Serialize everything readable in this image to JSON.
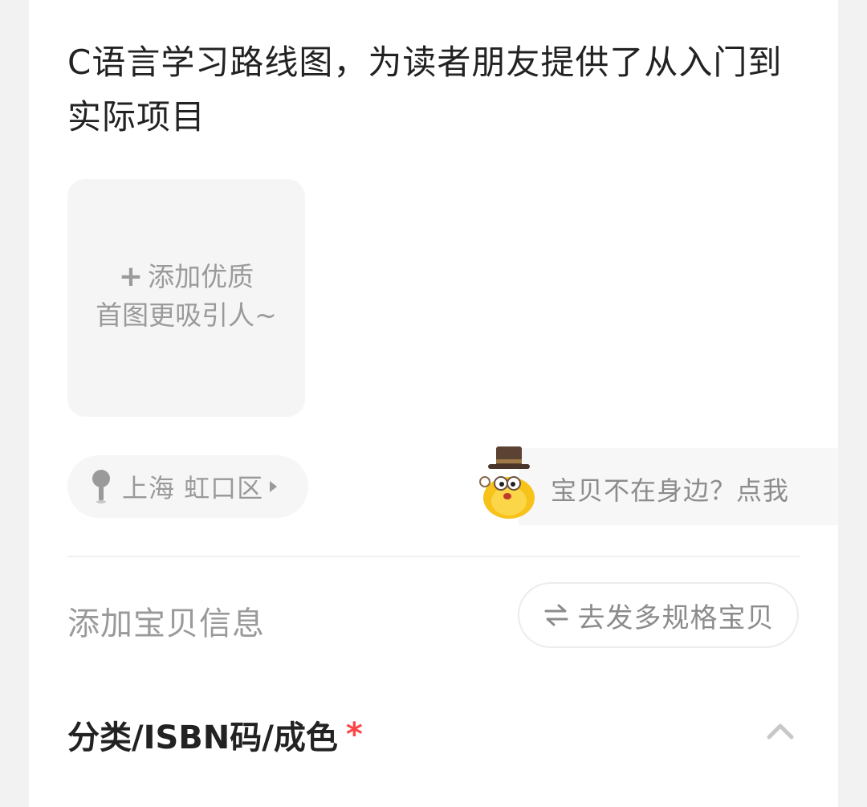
{
  "listing": {
    "description": "C语言学习路线图，为读者朋友提供了从入门到实际项目"
  },
  "photo_uploader": {
    "line1": "添加优质",
    "line2": "首图更吸引人~",
    "icon": "plus-icon"
  },
  "location": {
    "text": "上海 虹口区",
    "icon": "pin-icon"
  },
  "helper": {
    "text": "宝贝不在身边？点我",
    "icon": "mascot-icon"
  },
  "item_info": {
    "section_title": "添加宝贝信息",
    "multi_spec_button": "去发多规格宝贝",
    "multi_spec_icon": "swap-icon"
  },
  "category": {
    "label": "分类/ISBN码/成色",
    "required_mark": "*",
    "icon": "chevron-up-icon"
  },
  "colors": {
    "background": "#f2f2f2",
    "card": "#ffffff",
    "text_primary": "#222222",
    "text_secondary": "#9a9a9a",
    "required": "#ff4444"
  }
}
